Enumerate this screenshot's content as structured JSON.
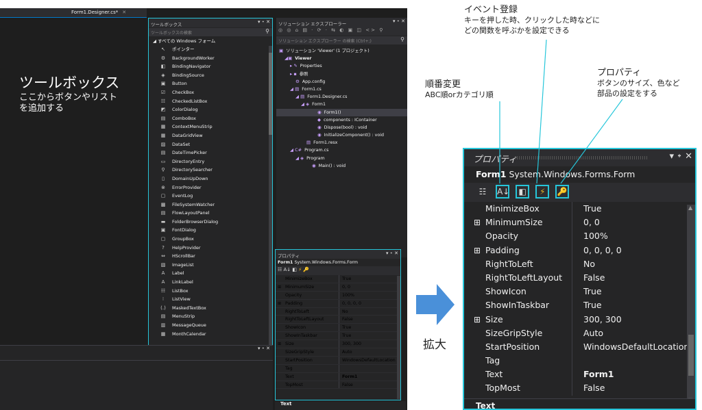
{
  "editor": {
    "tab_label": "Form1.Designer.cs*",
    "title": "ツールボックス",
    "subtitle_line1": "ここからボタンやリスト",
    "subtitle_line2": "を追加する"
  },
  "toolbox": {
    "title": "ツールボックス",
    "controls": "▾ ᛭ ✕",
    "search_placeholder": "ツールボックスの検索",
    "category": "◢ すべての Windows フォーム",
    "items": [
      {
        "label": "ポインター",
        "icon": "↖"
      },
      {
        "label": "BackgroundWorker",
        "icon": "⚙"
      },
      {
        "label": "BindingNavigator",
        "icon": "◧"
      },
      {
        "label": "BindingSource",
        "icon": "◈"
      },
      {
        "label": "Button",
        "icon": "▣"
      },
      {
        "label": "CheckBox",
        "icon": "☑"
      },
      {
        "label": "CheckedListBox",
        "icon": "☷"
      },
      {
        "label": "ColorDialog",
        "icon": "◩"
      },
      {
        "label": "ComboBox",
        "icon": "▤"
      },
      {
        "label": "ContextMenuStrip",
        "icon": "▦"
      },
      {
        "label": "DataGridView",
        "icon": "▦"
      },
      {
        "label": "DataSet",
        "icon": "▨"
      },
      {
        "label": "DateTimePicker",
        "icon": "▤"
      },
      {
        "label": "DirectoryEntry",
        "icon": "▭"
      },
      {
        "label": "DirectorySearcher",
        "icon": "⚲"
      },
      {
        "label": "DomainUpDown",
        "icon": "▯"
      },
      {
        "label": "ErrorProvider",
        "icon": "⊗"
      },
      {
        "label": "EventLog",
        "icon": "▢"
      },
      {
        "label": "FileSystemWatcher",
        "icon": "▩"
      },
      {
        "label": "FlowLayoutPanel",
        "icon": "▤"
      },
      {
        "label": "FolderBrowserDialog",
        "icon": "▬"
      },
      {
        "label": "FontDialog",
        "icon": "▣"
      },
      {
        "label": "GroupBox",
        "icon": "▢"
      },
      {
        "label": "HelpProvider",
        "icon": "?"
      },
      {
        "label": "HScrollBar",
        "icon": "⇔"
      },
      {
        "label": "ImageList",
        "icon": "▧"
      },
      {
        "label": "Label",
        "icon": "A"
      },
      {
        "label": "LinkLabel",
        "icon": "A"
      },
      {
        "label": "ListBox",
        "icon": "☷"
      },
      {
        "label": "ListView",
        "icon": "⁝"
      },
      {
        "label": "MaskedTextBox",
        "icon": "(.)"
      },
      {
        "label": "MenuStrip",
        "icon": "▤"
      },
      {
        "label": "MessageQueue",
        "icon": "▥"
      },
      {
        "label": "MonthCalendar",
        "icon": "▦"
      }
    ]
  },
  "solution": {
    "title": "ソリューション エクスプローラー",
    "controls": "▾ ᛭ ✕",
    "toolbar": "◎ ◎ ⌂ ▤ · ⟳ · ⇆ ◐ ▣ ◫ <> ⚲",
    "search_placeholder": "ソリューション エクスプローラー の検索 (Ctrl+;)",
    "items": [
      {
        "indent": 4,
        "icon": "▣",
        "label": "ソリューション 'Viewer' (1 プロジェクト)",
        "bold": false
      },
      {
        "indent": 12,
        "icon": "◢▣",
        "label": "Viewer",
        "bold": true
      },
      {
        "indent": 20,
        "icon": "▸ ✎",
        "label": "Properties",
        "bold": false
      },
      {
        "indent": 20,
        "icon": "▸ ▪",
        "label": "参照",
        "bold": false
      },
      {
        "indent": 28,
        "icon": "⚙",
        "label": "App.config",
        "bold": false
      },
      {
        "indent": 20,
        "icon": "◢ ▤",
        "label": "Form1.cs",
        "bold": false
      },
      {
        "indent": 28,
        "icon": "◢ ▤",
        "label": "Form1.Designer.cs",
        "bold": false
      },
      {
        "indent": 36,
        "icon": "◢ ◈",
        "label": "Form1",
        "bold": false
      },
      {
        "indent": 60,
        "icon": "◉",
        "label": "Form1()",
        "bold": false,
        "selected": true
      },
      {
        "indent": 60,
        "icon": "◆",
        "label": "components : IContainer",
        "bold": false
      },
      {
        "indent": 60,
        "icon": "◉",
        "label": "Dispose(bool) : void",
        "bold": false
      },
      {
        "indent": 60,
        "icon": "◉",
        "label": "InitializeComponent() : void",
        "bold": false
      },
      {
        "indent": 44,
        "icon": "▤",
        "label": "Form1.resx",
        "bold": false
      },
      {
        "indent": 20,
        "icon": "◢ C#",
        "label": "Program.cs",
        "bold": false
      },
      {
        "indent": 28,
        "icon": "◢ ◈",
        "label": "Program",
        "bold": false
      },
      {
        "indent": 52,
        "icon": "◉",
        "label": "Main() : void",
        "bold": false
      }
    ]
  },
  "bottom_panel": {
    "controls": "▾ ᛭ ✕"
  },
  "properties": {
    "title": "プロパティ",
    "controls": "▾ ᛭ ✕",
    "object_name": "Form1",
    "object_type": "System.Windows.Forms.Form",
    "description_label": "Text",
    "rows": [
      {
        "name": "MinimizeBox",
        "value": "True",
        "expand": false,
        "bold": false
      },
      {
        "name": "MinimumSize",
        "value": "0, 0",
        "expand": true,
        "bold": false
      },
      {
        "name": "Opacity",
        "value": "100%",
        "expand": false,
        "bold": false
      },
      {
        "name": "Padding",
        "value": "0, 0, 0, 0",
        "expand": true,
        "bold": false
      },
      {
        "name": "RightToLeft",
        "value": "No",
        "expand": false,
        "bold": false
      },
      {
        "name": "RightToLeftLayout",
        "value": "False",
        "expand": false,
        "bold": false
      },
      {
        "name": "ShowIcon",
        "value": "True",
        "expand": false,
        "bold": false
      },
      {
        "name": "ShowInTaskbar",
        "value": "True",
        "expand": false,
        "bold": false
      },
      {
        "name": "Size",
        "value": "300, 300",
        "expand": true,
        "bold": false
      },
      {
        "name": "SizeGripStyle",
        "value": "Auto",
        "expand": false,
        "bold": false
      },
      {
        "name": "StartPosition",
        "value": "WindowsDefaultLocation",
        "expand": false,
        "bold": false
      },
      {
        "name": "Tag",
        "value": "",
        "expand": false,
        "bold": false
      },
      {
        "name": "Text",
        "value": "Form1",
        "expand": false,
        "bold": true
      },
      {
        "name": "TopMost",
        "value": "False",
        "expand": false,
        "bold": false
      }
    ],
    "tool_icons": {
      "categorized": "☷",
      "alphabetical": "A↓",
      "properties": "◧",
      "events": "⚡",
      "pages": "🔑"
    }
  },
  "zoom_label": "拡大",
  "annotations": {
    "order_title": "順番変更",
    "order_desc": "ABC順orカテゴリ順",
    "event_title": "イベント登録",
    "event_desc1": "キーを押した時、クリックした時などに",
    "event_desc2": "どの関数を呼ぶかを設定できる",
    "prop_title": "プロパティ",
    "prop_desc1": "ボタンのサイズ、色など",
    "prop_desc2": "部品の設定をする"
  },
  "colors": {
    "accent": "#26c6da",
    "arrow": "#4a90d9",
    "ide_bg": "#1e1e1e",
    "panel_bg": "#252526"
  }
}
